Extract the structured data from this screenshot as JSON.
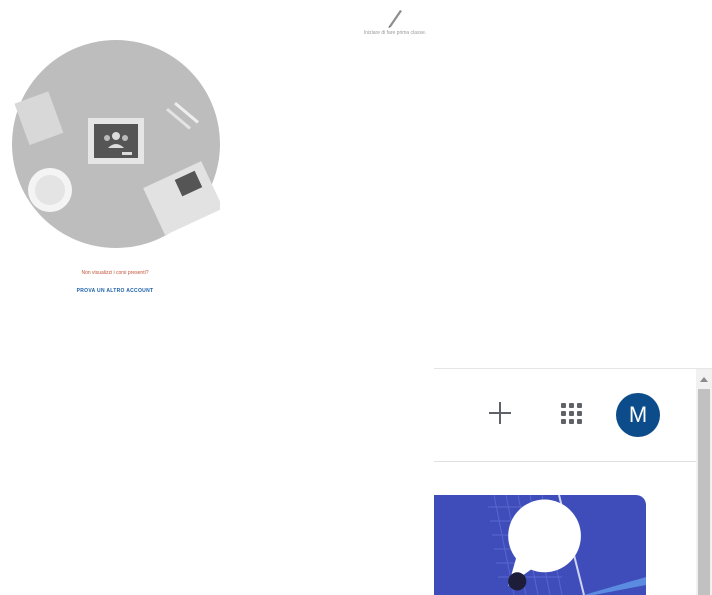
{
  "hint": {
    "text": "Iniziare di fare prima classe."
  },
  "prompt": {
    "question": "Non visualizzi i corsi presenti?",
    "link": "PROVA UN ALTRO ACCOUNT"
  },
  "panel": {
    "avatar_letter": "M"
  },
  "icons": {
    "pen": "pen-icon",
    "classroom": "classroom-logo-icon",
    "add": "plus-icon",
    "apps": "apps-grid-icon",
    "bubble": "speech-bubble-icon",
    "scroll_up": "scroll-up-arrow-icon"
  },
  "colors": {
    "avatar_bg": "#0d4c8a",
    "banner_bg": "#3f4dbb",
    "link": "#1a5fa8",
    "question": "#c0543a",
    "illustration_bg": "#bdbdbd"
  }
}
